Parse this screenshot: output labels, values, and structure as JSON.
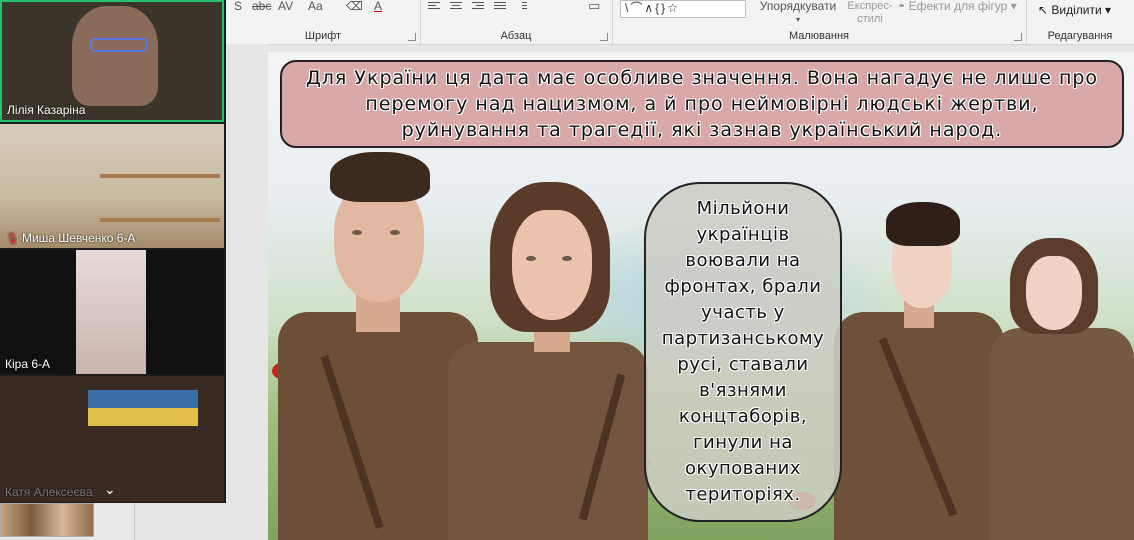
{
  "ribbon": {
    "groups": [
      "Шрифт",
      "Абзац",
      "Малювання",
      "Редагування"
    ],
    "font": {
      "strike": "abc",
      "spacing": "AV",
      "case": "Aa",
      "color": "A"
    },
    "drawing": {
      "shapes_sample": "\\⌒∧{}☆",
      "arrange": "Упорядкувати",
      "quick_styles": "Експрес-стилі",
      "shape_effects": "Ефекти для фігур"
    },
    "editing": {
      "select": "Виділити"
    }
  },
  "participants": [
    {
      "name": "Лілія Казаріна"
    },
    {
      "name": "Миша Шевченко 6-А"
    },
    {
      "name": "Кіра 6-А"
    },
    {
      "name": "Катя Алексеєва"
    }
  ],
  "slide": {
    "top_text": "Для України ця дата має особливе значення. Вона нагадує не лише про перемогу над нацизмом, а й про неймовірні людські жертви, руйнування та трагедії, які зазнав український народ.",
    "side_text": "Мільйони\nукраїнців\nвоювали на\nфронтах, брали\nучасть у\nпартизанському\nрусі, ставали\nв'язнями\nконцтаборів,\nгинули на\nокупованих\nтериторіях."
  },
  "colors": {
    "active_speaker": "#23c26b",
    "top_box_bg": "#d9a8a9",
    "side_box_bg": "#cdcdc3",
    "uniform": "#6c4f36",
    "poppy": "#c8241c"
  }
}
